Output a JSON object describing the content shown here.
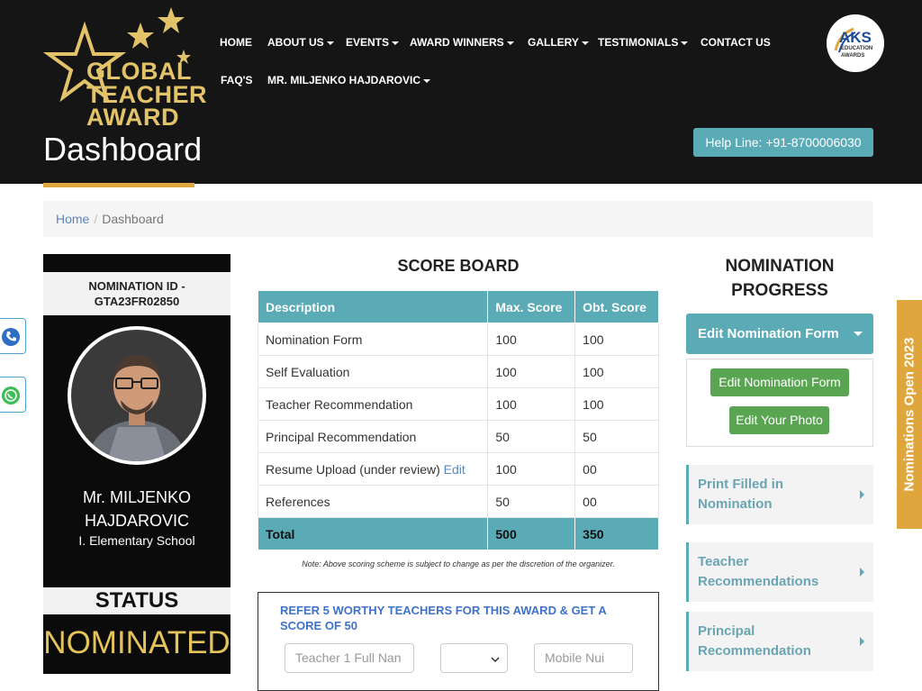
{
  "nav": {
    "row1": [
      "HOME",
      "ABOUT US",
      "EVENTS",
      "AWARD WINNERS",
      "GALLERY",
      "TESTIMONIALS",
      "CONTACT US"
    ],
    "row2": [
      "FAQ'S",
      "MR. MILJENKO HAJDAROVIC"
    ]
  },
  "logo": {
    "line1": "GLOBAL",
    "line2": "TEACHER",
    "line3": "AWARD"
  },
  "aks": {
    "name": "AKS",
    "sub1": "EDUCATION",
    "sub2": "AWARDS"
  },
  "page_title": "Dashboard",
  "helpline": "Help Line: +91-8700006030",
  "breadcrumb": {
    "home": "Home",
    "sep": "/",
    "current": "Dashboard"
  },
  "card": {
    "id_label": "NOMINATION ID -",
    "id_value": "GTA23FR02850",
    "name_line1": "Mr. MILJENKO",
    "name_line2": "HAJDAROVIC",
    "school": "I. Elementary School",
    "status_label": "STATUS",
    "status_value": "NOMINATED"
  },
  "scoreboard": {
    "title": "SCORE BOARD",
    "headers": [
      "Description",
      "Max. Score",
      "Obt. Score"
    ],
    "rows": [
      {
        "desc": "Nomination Form",
        "max": "100",
        "obt": "100"
      },
      {
        "desc": "Self Evaluation",
        "max": "100",
        "obt": "100"
      },
      {
        "desc": "Teacher Recommendation",
        "max": "100",
        "obt": "100"
      },
      {
        "desc": "Principal Recommendation",
        "max": "50",
        "obt": "50"
      },
      {
        "desc": "Resume Upload (under review)",
        "max": "100",
        "obt": "00",
        "link": "Edit"
      },
      {
        "desc": "References",
        "max": "50",
        "obt": "00"
      }
    ],
    "total": {
      "desc": "Total",
      "max": "500",
      "obt": "350"
    },
    "note": "Note: Above scoring scheme is subject to change as per the discretion of the organizer."
  },
  "refer": {
    "title": "REFER 5 WORTHY TEACHERS FOR THIS AWARD & GET A SCORE OF 50",
    "name_placeholder": "Teacher 1 Full Nan",
    "select_value": "",
    "mobile_placeholder": "Mobile Nui"
  },
  "progress": {
    "title": "NOMINATION PROGRESS",
    "toggle": "Edit Nomination Form",
    "buttons": [
      "Edit Nomination Form",
      "Edit Your Photo"
    ],
    "cards": [
      {
        "l1": "Print Filled in",
        "l2": "Nomination"
      },
      {
        "l1": "Teacher",
        "l2": "Recommendations"
      },
      {
        "l1": "Principal",
        "l2": "Recommendation"
      }
    ]
  },
  "side_tab": "Nominations Open 2023",
  "colors": {
    "teal": "#5aabb6",
    "gold": "#e0a63e",
    "green": "#5aa552",
    "dark": "#151515"
  }
}
